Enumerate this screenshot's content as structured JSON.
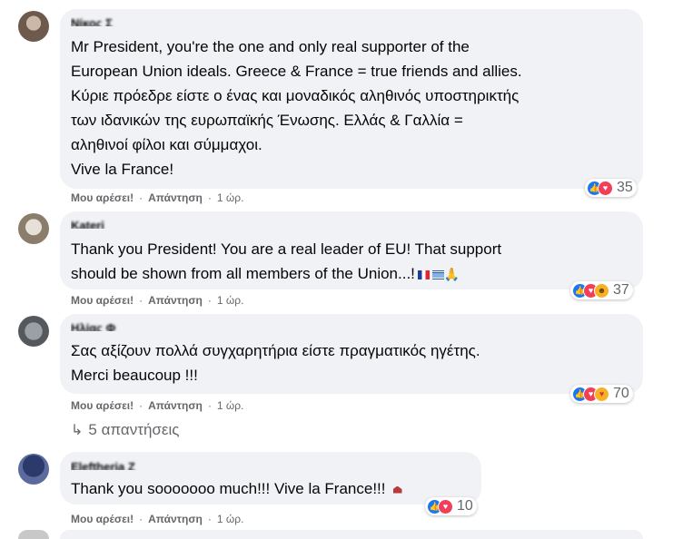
{
  "comments": [
    {
      "author": "Νίκος Σ",
      "text": "Mr President, you're the one and only real supporter of the\nEuropean Union ideals. Greece & France = true friends and allies.\nΚύριε πρόεδρε είστε ο ένας και μοναδικός αληθινός υποστηρικτής\nτων ιδανικών της ευρωπαϊκής Ένωσης. Ελλάς & Γαλλία =\nαληθινοί φίλοι και σύμμαχοι.\nVive la France!",
      "like_label": "Μου αρέσει!",
      "reply_label": "Απάντηση",
      "time": "1 ώρ.",
      "reactions": [
        "like",
        "love"
      ],
      "reaction_count": "35"
    },
    {
      "author": "Kateri",
      "text": "Thank you President! You are a real leader of EU! That support\nshould be shown from all members of the Union...!",
      "like_label": "Μου αρέσει!",
      "reply_label": "Απάντηση",
      "time": "1 ώρ.",
      "reactions": [
        "like",
        "love",
        "haha"
      ],
      "reaction_count": "37"
    },
    {
      "author": "Ηλίας Φ",
      "text": "Σας αξίζουν πολλά συγχαρητήρια είστε πραγματικός ηγέτης.\nMerci beaucoup !!!",
      "like_label": "Μου αρέσει!",
      "reply_label": "Απάντηση",
      "time": "1 ώρ.",
      "reactions": [
        "like",
        "love",
        "care"
      ],
      "reaction_count": "70"
    },
    {
      "author": "Eleftheria Z",
      "text": "Thank you sooooooo much!!! Vive la France!!!",
      "like_label": "Μου αρέσει!",
      "reply_label": "Απάντηση",
      "time": "1 ώρ.",
      "reactions": [
        "like",
        "love"
      ],
      "reaction_count": "10"
    }
  ],
  "replies_link": "5 απαντήσεις",
  "icons": {
    "reply_arrow": "reply-arrow-icon",
    "flags": [
      "france-flag",
      "greece-flag"
    ],
    "pray": "pray-icon",
    "house": "house-icon"
  },
  "colors": {
    "bubble": "#f0f2f5",
    "secondary_text": "#65676b",
    "like": "#1877f2",
    "love": "#f33e58",
    "haha": "#f7b125"
  }
}
